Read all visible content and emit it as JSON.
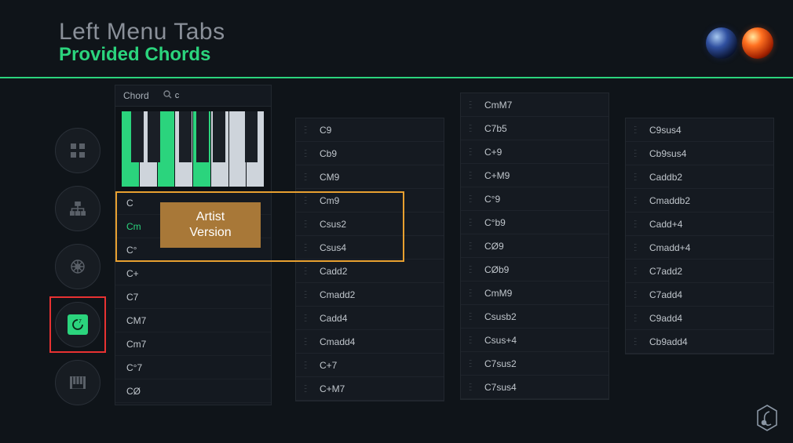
{
  "header": {
    "title": "Left Menu Tabs",
    "subtitle": "Provided Chords"
  },
  "panel": {
    "label": "Chord",
    "search_value": "c"
  },
  "badge": {
    "line1": "Artist",
    "line2": "Version"
  },
  "sidebar_items": [
    {
      "name": "grid",
      "active": false
    },
    {
      "name": "hierarchy",
      "active": false
    },
    {
      "name": "wheel",
      "active": false
    },
    {
      "name": "chord-symbol",
      "active": true
    },
    {
      "name": "piano",
      "active": false
    }
  ],
  "piano": {
    "white_on": [
      0,
      2,
      4
    ],
    "black_positions": [
      6.5,
      18,
      40,
      52,
      63.5,
      86
    ]
  },
  "panel_chords": [
    {
      "label": "C",
      "on": false
    },
    {
      "label": "Cm",
      "on": true
    },
    {
      "label": "C°",
      "on": false
    },
    {
      "label": "C+",
      "on": false
    },
    {
      "label": "C7",
      "on": false
    },
    {
      "label": "CM7",
      "on": false
    },
    {
      "label": "Cm7",
      "on": false
    },
    {
      "label": "C°7",
      "on": false
    },
    {
      "label": "CØ",
      "on": false
    }
  ],
  "col2": [
    "C9",
    "Cb9",
    "CM9",
    "Cm9",
    "Csus2",
    "Csus4",
    "Cadd2",
    "Cmadd2",
    "Cadd4",
    "Cmadd4",
    "C+7",
    "C+M7"
  ],
  "col3": [
    "CmM7",
    "C7b5",
    "C+9",
    "C+M9",
    "C°9",
    "C°b9",
    "CØ9",
    "CØb9",
    "CmM9",
    "Csusb2",
    "Csus+4",
    "C7sus2",
    "C7sus4"
  ],
  "col4": [
    "C9sus4",
    "Cb9sus4",
    "Caddb2",
    "Cmaddb2",
    "Cadd+4",
    "Cmadd+4",
    "C7add2",
    "C7add4",
    "C9add4",
    "Cb9add4"
  ]
}
